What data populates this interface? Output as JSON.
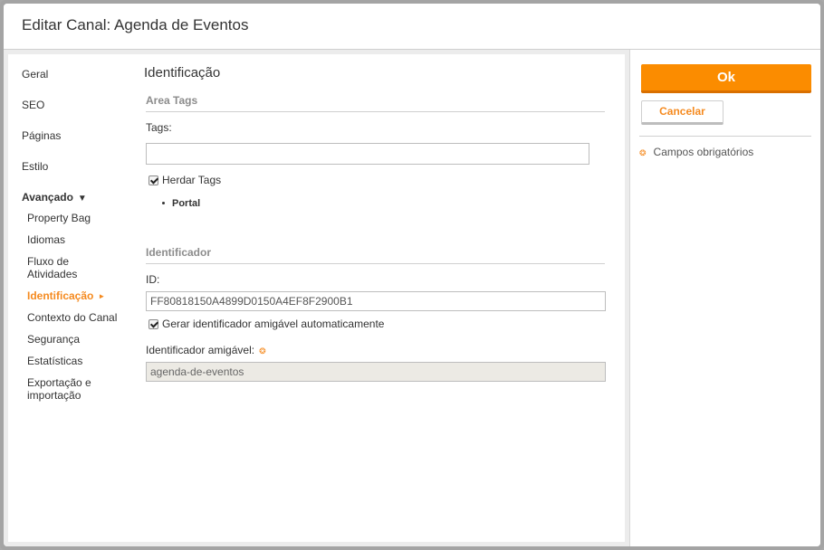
{
  "dialog": {
    "title": "Editar Canal: Agenda de Eventos"
  },
  "nav": {
    "geral": "Geral",
    "seo": "SEO",
    "paginas": "Páginas",
    "estilo": "Estilo",
    "avancado": "Avançado",
    "sub": {
      "property_bag": "Property Bag",
      "idiomas": "Idiomas",
      "fluxo": "Fluxo de Atividades",
      "identificacao": "Identificação",
      "contexto": "Contexto do Canal",
      "seguranca": "Segurança",
      "estatisticas": "Estatísticas",
      "exportacao": "Exportação e importação"
    }
  },
  "main": {
    "section_title": "Identificação",
    "area_tags": {
      "title": "Area Tags",
      "tags_label": "Tags:",
      "tags_value": "",
      "herdar_label": "Herdar Tags",
      "herdar_checked": true,
      "inherited": [
        "Portal"
      ]
    },
    "identificador": {
      "title": "Identificador",
      "id_label": "ID:",
      "id_value": "FF80818150A4899D0150A4EF8F2900B1",
      "gerar_label": "Gerar identificador amigável automaticamente",
      "gerar_checked": true,
      "amigavel_label": "Identificador amigável:",
      "amigavel_value": "agenda-de-eventos"
    }
  },
  "side": {
    "ok_label": "Ok",
    "cancel_label": "Cancelar",
    "required_note": "Campos obrigatórios"
  },
  "colors": {
    "accent": "#fb8c00",
    "active_nav": "#f58a1f",
    "group_title": "#8c8c8c"
  }
}
